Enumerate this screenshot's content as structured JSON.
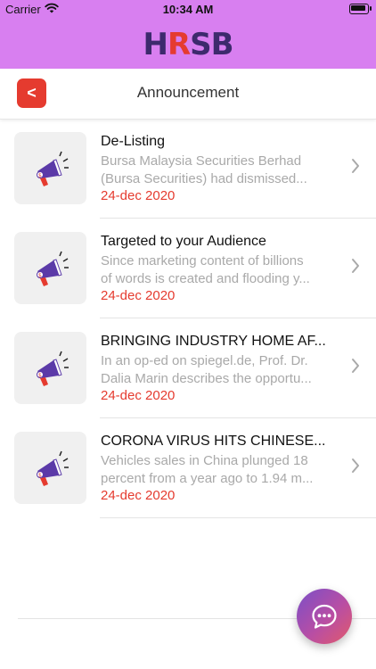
{
  "status_bar": {
    "carrier": "Carrier",
    "time": "10:34 AM"
  },
  "brand": {
    "logo_text_h": "H",
    "logo_text_r": "R",
    "logo_text_sb": "SB",
    "header_color": "#d87ff0"
  },
  "nav": {
    "back_symbol": "<",
    "title": "Announcement"
  },
  "announcements": [
    {
      "title": "De-Listing",
      "desc_line1": "Bursa Malaysia Securities Berhad",
      "desc_line2": "(Bursa Securities) had dismissed...",
      "date": "24-dec 2020"
    },
    {
      "title": "Targeted to your Audience",
      "desc_line1": "Since marketing content of billions",
      "desc_line2": "of words is created and flooding y...",
      "date": "24-dec 2020"
    },
    {
      "title": "BRINGING INDUSTRY HOME AF...",
      "desc_line1": "In an op-ed on spiegel.de, Prof. Dr.",
      "desc_line2": "Dalia Marin describes the opportu...",
      "date": "24-dec 2020"
    },
    {
      "title": "CORONA VIRUS HITS CHINESE...",
      "desc_line1": "Vehicles sales in China plunged 18",
      "desc_line2": "percent from a year ago to 1.94 m...",
      "date": "24-dec 2020"
    }
  ],
  "icons": {
    "announcement": "megaphone-icon",
    "chevron": "chevron-right-icon",
    "chat": "chat-bubble-icon"
  },
  "colors": {
    "accent_red": "#e53b2f",
    "muted_text": "#a9a9a9"
  }
}
